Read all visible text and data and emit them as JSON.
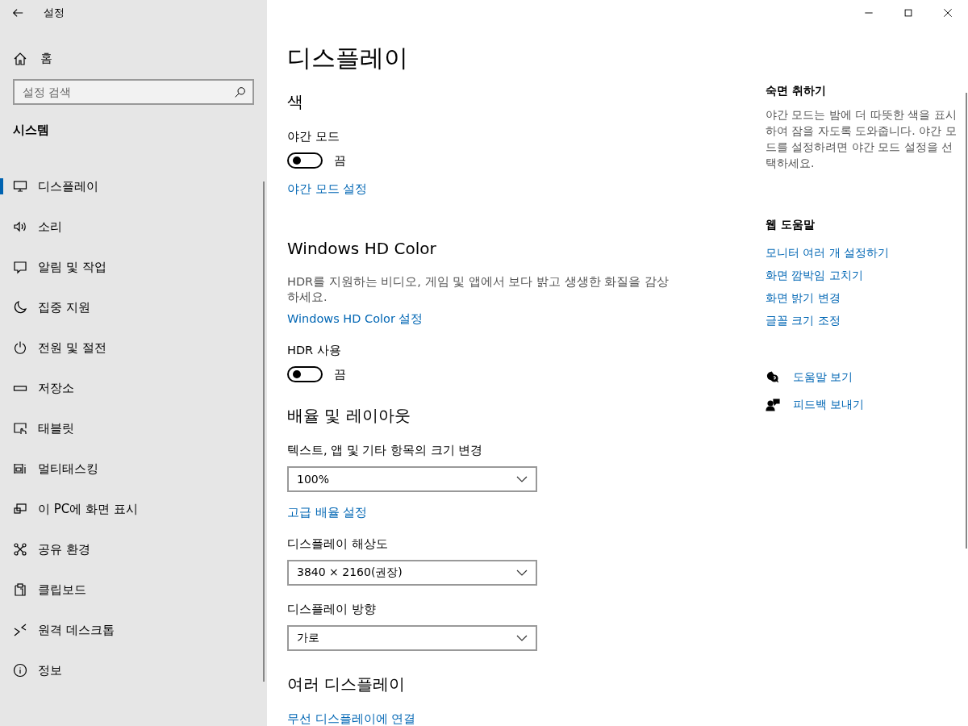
{
  "window": {
    "title": "설정"
  },
  "sidebar": {
    "home": "홈",
    "search": {
      "placeholder": "설정 검색"
    },
    "section": "시스템",
    "items": [
      {
        "label": "디스플레이",
        "selected": true
      },
      {
        "label": "소리",
        "selected": false
      },
      {
        "label": "알림 및 작업",
        "selected": false
      },
      {
        "label": "집중 지원",
        "selected": false
      },
      {
        "label": "전원 및 절전",
        "selected": false
      },
      {
        "label": "저장소",
        "selected": false
      },
      {
        "label": "태블릿",
        "selected": false
      },
      {
        "label": "멀티태스킹",
        "selected": false
      },
      {
        "label": "이 PC에 화면 표시",
        "selected": false
      },
      {
        "label": "공유 환경",
        "selected": false
      },
      {
        "label": "클립보드",
        "selected": false
      },
      {
        "label": "원격 데스크톱",
        "selected": false
      },
      {
        "label": "정보",
        "selected": false
      }
    ]
  },
  "main": {
    "title": "디스플레이",
    "sections": [
      {
        "heading": "색",
        "items": [
          {
            "kind": "toggle",
            "label": "야간 모드",
            "on": false,
            "state_text": "끔"
          },
          {
            "kind": "link",
            "text": "야간 모드 설정"
          }
        ]
      },
      {
        "heading": "Windows HD Color",
        "items": [
          {
            "kind": "description",
            "text": "HDR를 지원하는 비디오, 게임 및 앱에서 보다 밝고 생생한 화질을 감상하세요."
          },
          {
            "kind": "link",
            "text": "Windows HD Color 설정"
          },
          {
            "kind": "toggle",
            "label": "HDR 사용",
            "on": false,
            "state_text": "끔"
          }
        ]
      },
      {
        "heading": "배율 및 레이아웃",
        "items": [
          {
            "kind": "dropdown",
            "label": "텍스트, 앱 및 기타 항목의 크기 변경",
            "value": "100%"
          },
          {
            "kind": "link",
            "text": "고급 배율 설정"
          },
          {
            "kind": "dropdown",
            "label": "디스플레이 해상도",
            "value": "3840 × 2160(권장)"
          },
          {
            "kind": "dropdown",
            "label": "디스플레이 방향",
            "value": "가로"
          }
        ]
      },
      {
        "heading": "여러 디스플레이",
        "items": [
          {
            "kind": "link",
            "text": "무선 디스플레이에 연결"
          }
        ]
      }
    ]
  },
  "aside": {
    "sleep": {
      "heading": "숙면 취하기",
      "text": "야간 모드는 밤에 더 따뜻한 색을 표시하여 잠을 자도록 도와줍니다. 야간 모드를 설정하려면 야간 모드 설정을 선택하세요."
    },
    "web_help": {
      "heading": "웹 도움말",
      "links": [
        "모니터 여러 개 설정하기",
        "화면 깜박임 고치기",
        "화면 밝기 변경",
        "글꼴 크기 조정"
      ]
    },
    "actions": [
      "도움말 보기",
      "피드백 보내기"
    ]
  }
}
